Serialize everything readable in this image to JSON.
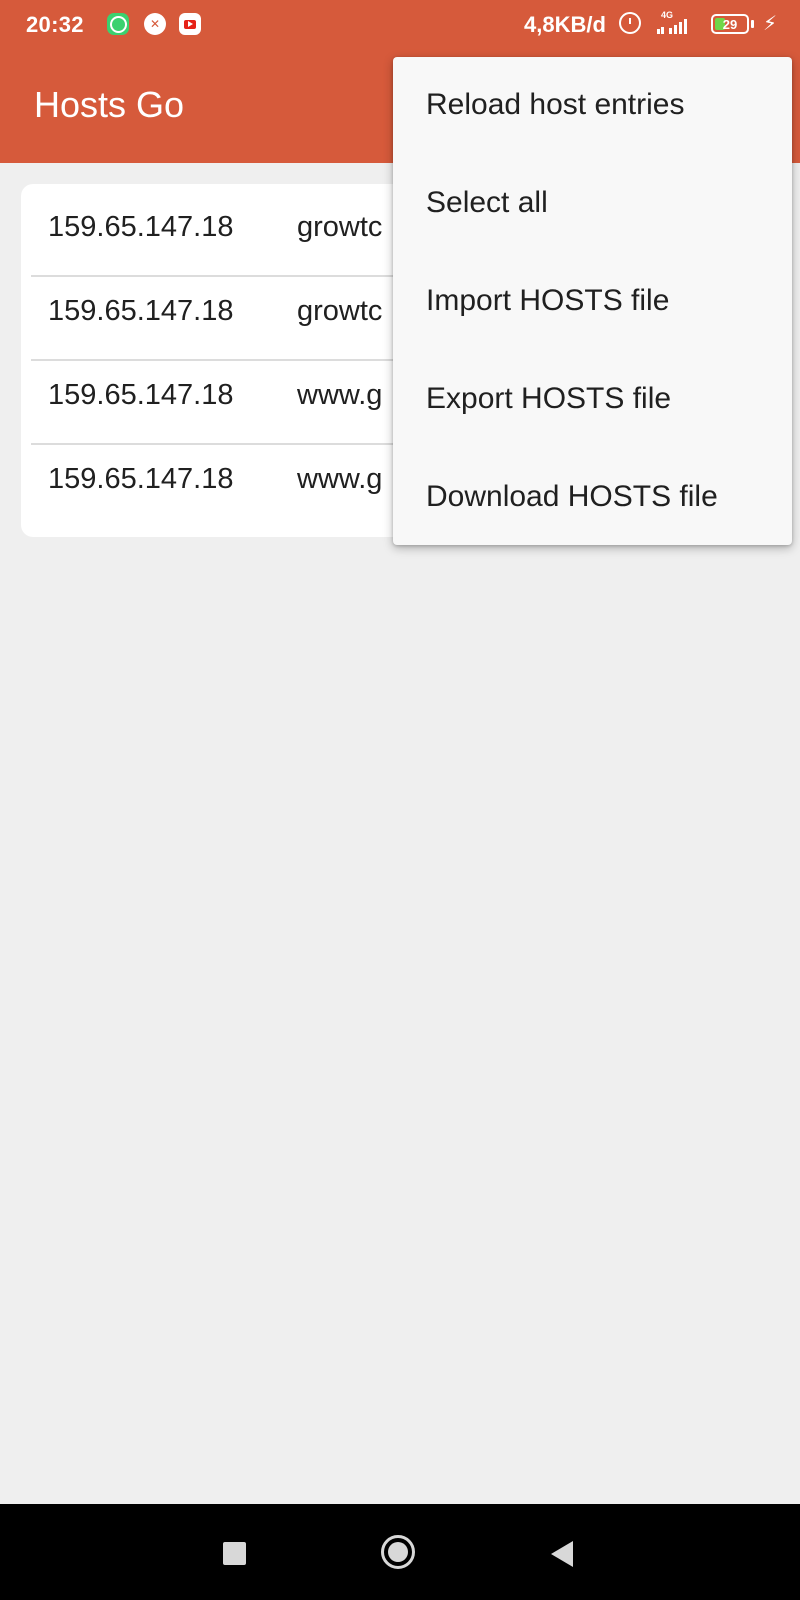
{
  "status_bar": {
    "time": "20:32",
    "net_speed": "4,8KB/d",
    "network_type": "4G",
    "battery_level": "29",
    "notifications": [
      "whatsapp-icon",
      "cross-app-icon",
      "youtube-icon"
    ],
    "background_color": "#d65a3b"
  },
  "app_bar": {
    "title": "Hosts Go",
    "background_color": "#d65a3b"
  },
  "hosts": [
    {
      "ip": "159.65.147.18",
      "hostname": "growtc"
    },
    {
      "ip": "159.65.147.18",
      "hostname": "growtc"
    },
    {
      "ip": "159.65.147.18",
      "hostname": "www.g"
    },
    {
      "ip": "159.65.147.18",
      "hostname": "www.g"
    }
  ],
  "overflow_menu": {
    "items": [
      {
        "label": "Reload host entries"
      },
      {
        "label": "Select all"
      },
      {
        "label": "Import HOSTS file"
      },
      {
        "label": "Export HOSTS file"
      },
      {
        "label": "Download HOSTS file"
      }
    ]
  },
  "nav_bar": {
    "buttons": [
      "recents-icon",
      "home-icon",
      "back-icon"
    ]
  }
}
